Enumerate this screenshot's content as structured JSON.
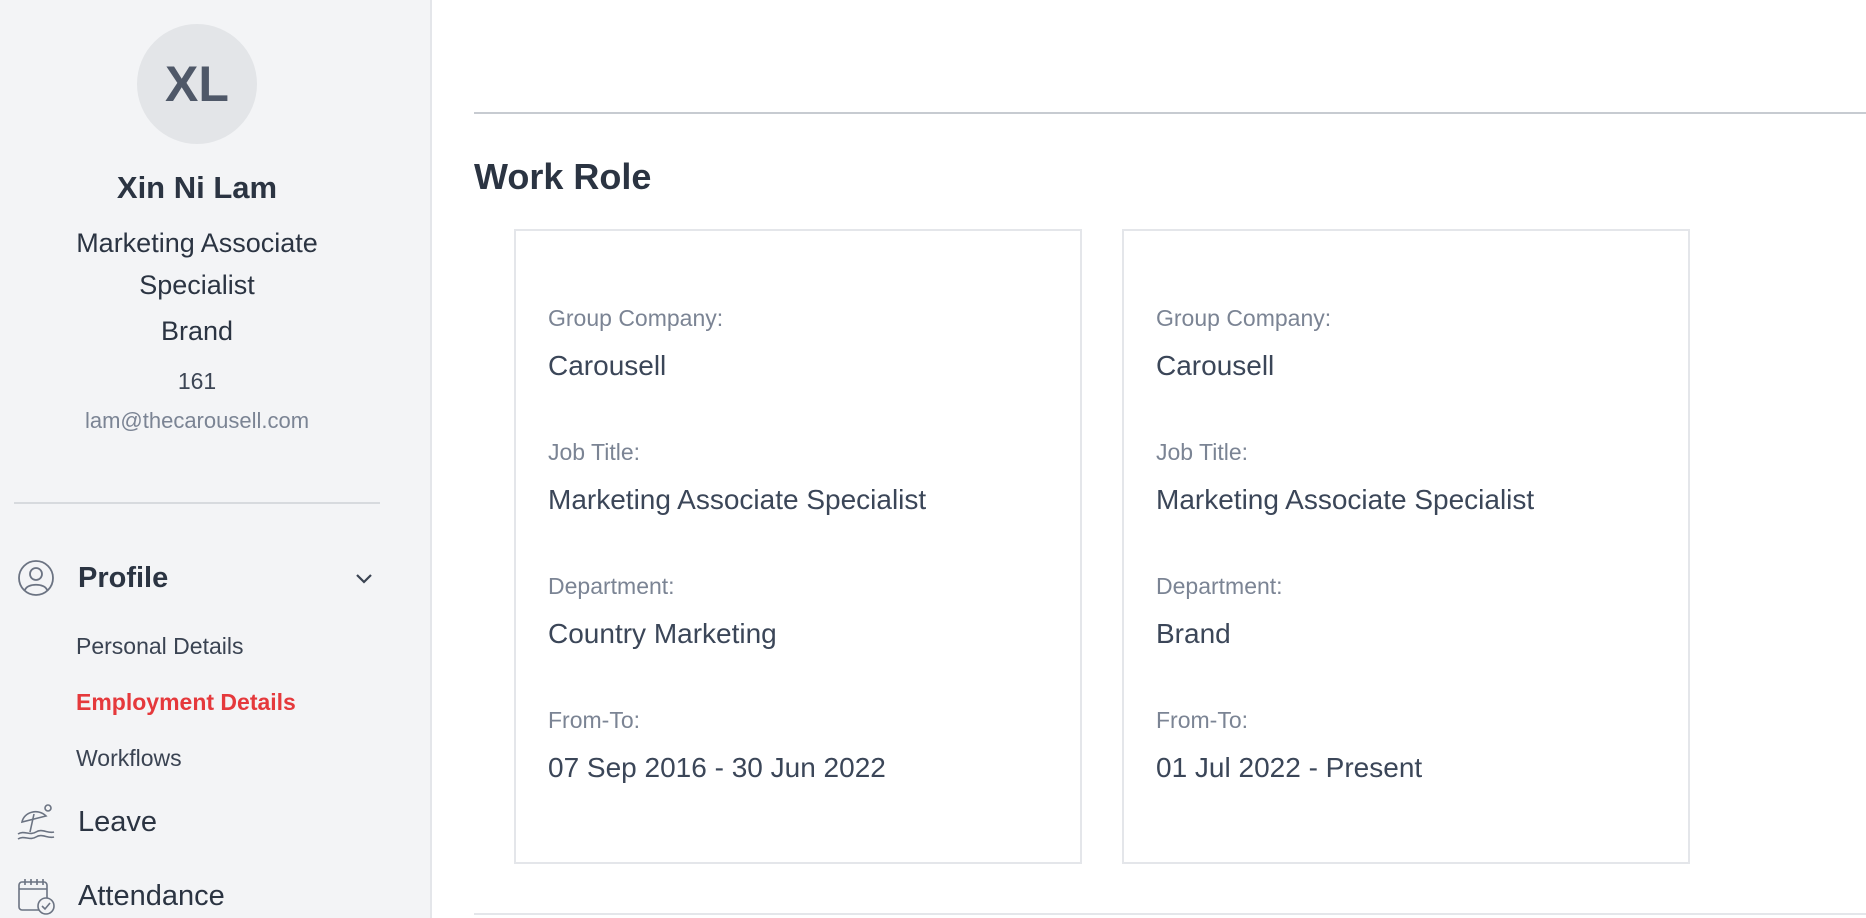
{
  "profile": {
    "initials": "XL",
    "name": "Xin Ni Lam",
    "title": "Marketing Associate Specialist",
    "department": "Brand",
    "employee_id": "161",
    "email": "lam@thecarousell.com"
  },
  "nav": {
    "profile": {
      "label": "Profile",
      "icon": "user-circle-icon",
      "sub_items": [
        "Personal Details",
        "Employment Details",
        "Workflows"
      ],
      "active_sub_item": "Employment Details"
    },
    "leave": {
      "label": "Leave",
      "icon": "beach-umbrella-icon"
    },
    "attendance": {
      "label": "Attendance",
      "icon": "calendar-check-icon"
    }
  },
  "main": {
    "section_title": "Work Role",
    "labels": {
      "group_company": "Group Company:",
      "job_title": "Job Title:",
      "department": "Department:",
      "from_to": "From-To:"
    },
    "roles": [
      {
        "group_company": "Carousell",
        "job_title": "Marketing Associate Specialist",
        "department": "Country Marketing",
        "from_to": "07 Sep 2016 - 30 Jun 2022"
      },
      {
        "group_company": "Carousell",
        "job_title": "Marketing Associate Specialist",
        "department": "Brand",
        "from_to": "01 Jul 2022 - Present"
      }
    ]
  },
  "colors": {
    "sidebar_bg": "#f3f4f6",
    "active_accent": "#e5393c",
    "text_primary": "#2b3442",
    "text_muted": "#7b8494"
  }
}
